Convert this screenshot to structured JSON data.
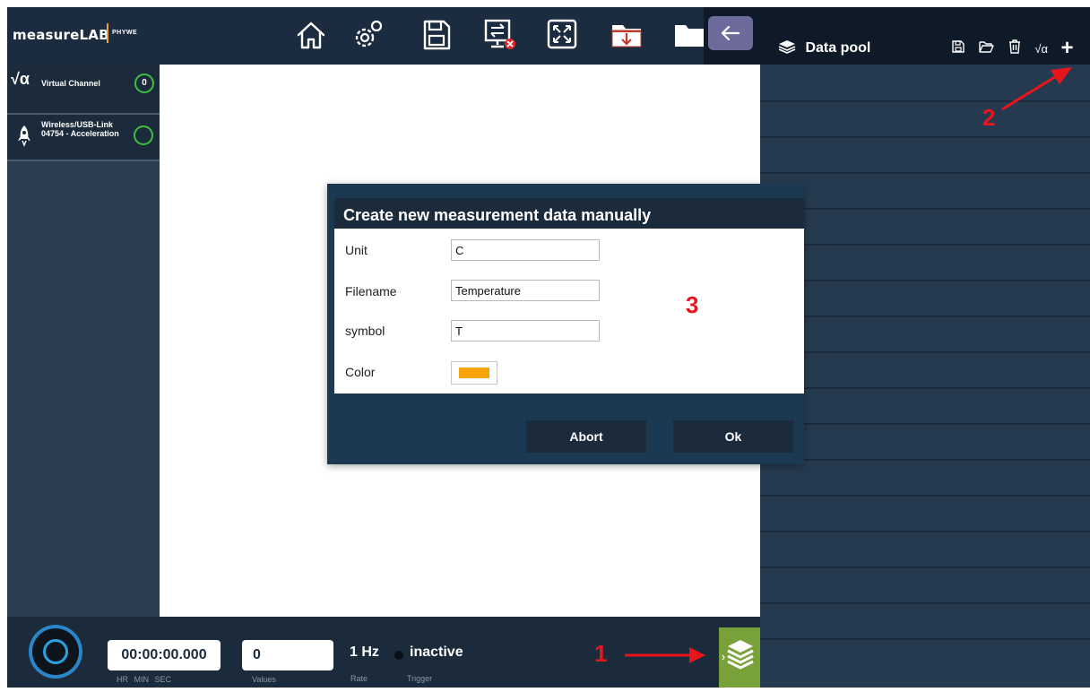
{
  "app": {
    "logo_text": "measureLAB",
    "brand_text": "PHYWE"
  },
  "toolbar": {
    "icons": [
      "home-icon",
      "settings-icon",
      "save-icon",
      "disconnect-icon",
      "fullscreen-icon",
      "import-folder-icon",
      "open-folder-icon"
    ]
  },
  "data_pool": {
    "title": "Data pool",
    "back_icon": "arrow-left-icon",
    "header_icons": [
      "save-icon",
      "open-folder-icon",
      "trash-icon"
    ],
    "sqrt_label": "√α",
    "add_label": "+"
  },
  "channels": [
    {
      "icon": "sqrt-alpha-icon",
      "icon_text": "√α",
      "label": "Virtual Channel",
      "count": "0"
    },
    {
      "icon": "rocket-icon",
      "label": "Wireless/USB-Link 04754 - Acceleration"
    }
  ],
  "bottom": {
    "timer": "00:00:00.000",
    "timer_sub": "HR MIN SEC",
    "values": "0",
    "values_sub": "Values",
    "rate": "1 Hz",
    "rate_sub": "Rate",
    "trigger_status": "inactive",
    "trigger_sub": "Trigger"
  },
  "dialog": {
    "title": "Create new measurement data manually",
    "fields": [
      {
        "label": "Unit",
        "value": "C"
      },
      {
        "label": "Filename",
        "value": "Temperature"
      },
      {
        "label": "symbol",
        "value": "T"
      },
      {
        "label": "Color",
        "value": "#f4a308"
      }
    ],
    "abort_label": "Abort",
    "ok_label": "Ok"
  },
  "annotations": {
    "one": "1",
    "two": "2",
    "three": "3"
  },
  "colors": {
    "header_bg": "#1c2c40",
    "sidebar_bg": "#2c3f52",
    "right_panel_bg": "#263a4f",
    "accent_green": "#79a13a",
    "annotation_red": "#e8151d",
    "dialog_bg": "#1c3954",
    "swatch_orange": "#f4a308"
  }
}
